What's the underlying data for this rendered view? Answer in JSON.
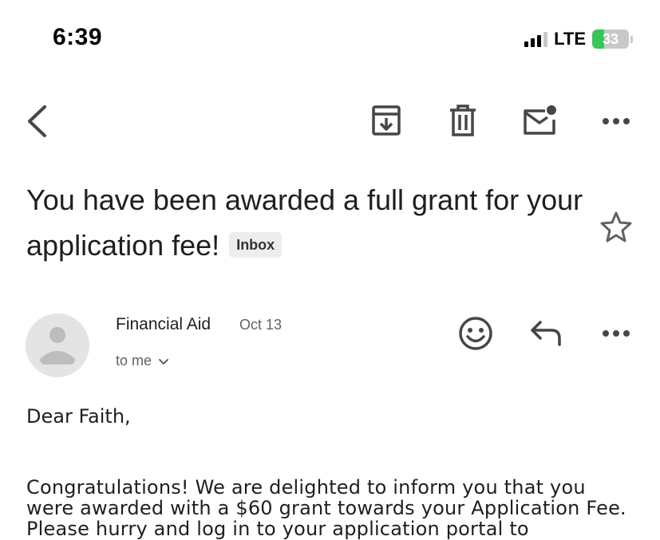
{
  "status_bar": {
    "time": "6:39",
    "network": "LTE",
    "battery": "33",
    "battery_level_percent": 33,
    "signal_bars_active": 3,
    "signal_bars_total": 4
  },
  "toolbar": {
    "icons": [
      "back-arrow-icon",
      "archive-icon",
      "trash-icon",
      "mark-unread-icon",
      "more-horizontal-icon"
    ]
  },
  "email": {
    "subject": "You have been awarded a full grant for your application fee!",
    "label": "Inbox",
    "sender": "Financial Aid",
    "date": "Oct 13",
    "recipient": "to me",
    "greeting": "Dear Faith,",
    "body": "Congratulations! We are delighted to inform you that you were awarded with a $60 grant towards your Application Fee. Please hurry and log in to your application portal to"
  },
  "colors": {
    "text_primary": "#1f1f1f",
    "text_secondary": "#5f6368",
    "icon": "#444746",
    "battery_green": "#34c759",
    "badge_bg": "#ededed",
    "avatar_bg": "#e4e4e4"
  }
}
